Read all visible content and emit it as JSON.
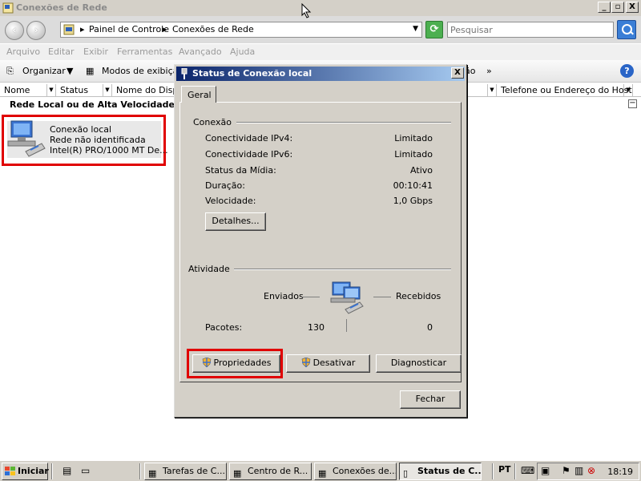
{
  "window": {
    "title": "Conexões de Rede",
    "minimize": "_",
    "maximize": "▫",
    "close": "X"
  },
  "address": {
    "crumbs": [
      "Painel de Controle",
      "Conexões de Rede"
    ],
    "search_placeholder": "Pesquisar"
  },
  "menubar": [
    "Arquivo",
    "Editar",
    "Exibir",
    "Ferramentas",
    "Avançado",
    "Ajuda"
  ],
  "toolbar": {
    "organize": "Organizar",
    "view_modes": "Modos de exibição",
    "hidden_suffix": "ão",
    "more": "»",
    "help": "?"
  },
  "columns": [
    "Nome",
    "Status",
    "Nome do Dispo",
    "Telefone ou Endereço do Host"
  ],
  "group": {
    "header": "Rede Local ou de Alta Velocidade co",
    "collapse": "−"
  },
  "connection": {
    "name": "Conexão local",
    "network": "Rede não identificada",
    "device": "Intel(R) PRO/1000 MT De..."
  },
  "dialog": {
    "title": "Status de Conexão local",
    "close": "X",
    "tab": "Geral",
    "section_connection": "Conexão",
    "rows": [
      {
        "label": "Conectividade IPv4:",
        "value": "Limitado"
      },
      {
        "label": "Conectividade IPv6:",
        "value": "Limitado"
      },
      {
        "label": "Status da Mídia:",
        "value": "Ativo"
      },
      {
        "label": "Duração:",
        "value": "00:10:41"
      },
      {
        "label": "Velocidade:",
        "value": "1,0 Gbps"
      }
    ],
    "details_button": "Detalhes...",
    "section_activity": "Atividade",
    "sent_label": "Enviados",
    "received_label": "Recebidos",
    "packets_label": "Pacotes:",
    "packets_sent": "130",
    "packets_received": "0",
    "properties_button": "Propriedades",
    "disable_button": "Desativar",
    "diagnose_button": "Diagnosticar",
    "close_button": "Fechar"
  },
  "taskbar": {
    "start": "Iniciar",
    "tasks": [
      "Tarefas de C...",
      "Centro de R...",
      "Conexões de...",
      "Status de C..."
    ],
    "language": "PT",
    "clock": "18:19"
  },
  "colors": {
    "highlight": "#e00000",
    "dialog_title_start": "#0a246a",
    "dialog_title_end": "#a6caf0",
    "chrome": "#d4d0c8"
  }
}
